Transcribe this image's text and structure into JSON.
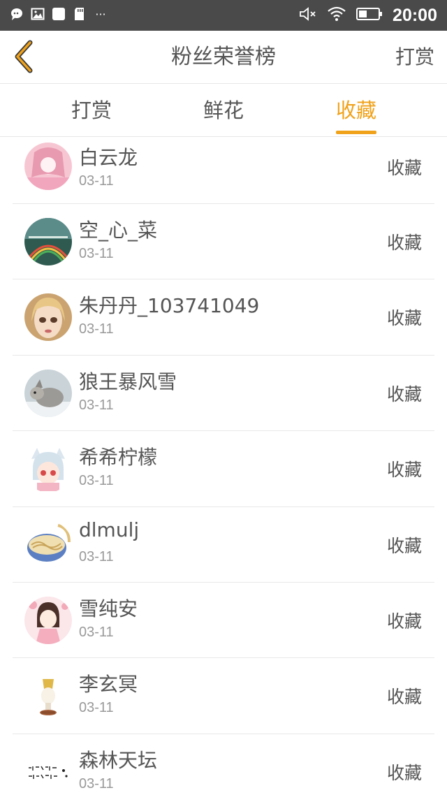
{
  "status_bar": {
    "time": "20:00",
    "left_icons": [
      "chat-notification-icon",
      "image-icon",
      "app-square-icon",
      "sd-card-icon",
      "more-dots-icon"
    ],
    "more_dots": "···",
    "right_icons": [
      "mute-icon",
      "wifi-icon",
      "battery-icon"
    ]
  },
  "header": {
    "title": "粉丝荣誉榜",
    "action_label": "打赏",
    "back_icon": "chevron-left-icon"
  },
  "tabs": [
    {
      "label": "打赏",
      "active": false
    },
    {
      "label": "鲜花",
      "active": false
    },
    {
      "label": "收藏",
      "active": true
    }
  ],
  "colors": {
    "accent": "#f0a21a",
    "status_bar": "#4a4a4a",
    "text": "#555555",
    "subtext": "#999999"
  },
  "list": [
    {
      "name": "白云龙",
      "date": "03-11",
      "type": "收藏",
      "avatar": "pink-anime-girl-avatar"
    },
    {
      "name": "空_心_菜",
      "date": "03-11",
      "type": "收藏",
      "avatar": "rainbow-landscape-avatar"
    },
    {
      "name": "朱丹丹_103741049",
      "date": "03-11",
      "type": "收藏",
      "avatar": "blonde-doll-avatar"
    },
    {
      "name": "狼王暴风雪",
      "date": "03-11",
      "type": "收藏",
      "avatar": "arctic-fox-avatar"
    },
    {
      "name": "希希柠檬",
      "date": "03-11",
      "type": "收藏",
      "avatar": "cat-ear-anime-girl-avatar"
    },
    {
      "name": "dlmulj",
      "date": "03-11",
      "type": "收藏",
      "avatar": "noodle-bowl-avatar"
    },
    {
      "name": "雪纯安",
      "date": "03-11",
      "type": "收藏",
      "avatar": "pink-kimono-girl-avatar"
    },
    {
      "name": "李玄冥",
      "date": "03-11",
      "type": "收藏",
      "avatar": "chess-piece-avatar"
    },
    {
      "name": "森林天坛",
      "date": "03-11",
      "type": "收藏",
      "avatar": "calligraphy-avatar"
    }
  ]
}
